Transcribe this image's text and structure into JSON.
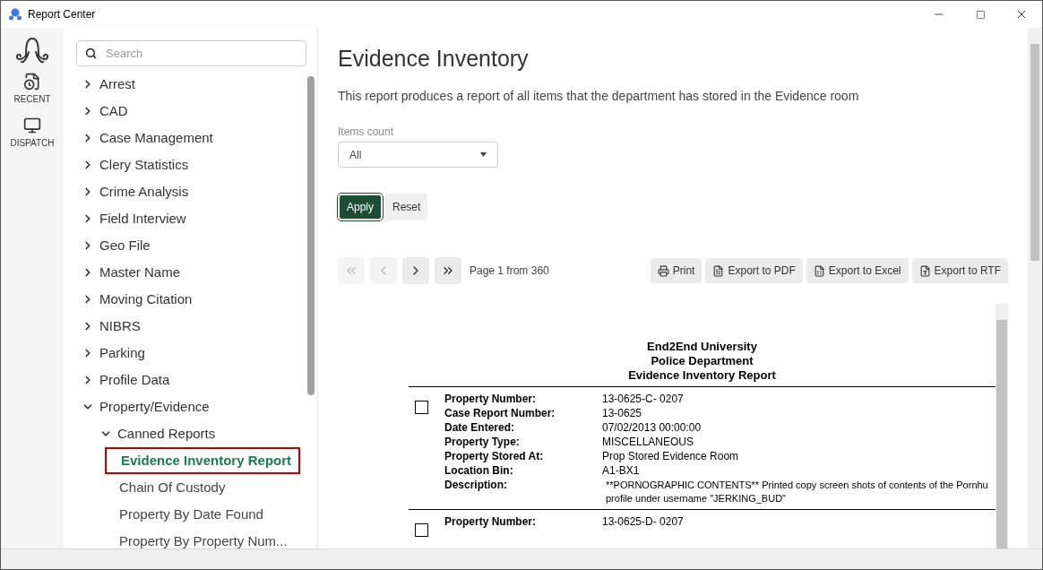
{
  "window": {
    "title": "Report Center"
  },
  "rail": [
    {
      "label": "RECENT",
      "kind": "recent"
    },
    {
      "label": "DISPATCH",
      "kind": "dispatch"
    }
  ],
  "tree": {
    "search": {
      "placeholder": "Search"
    },
    "items": [
      {
        "label": "Arrest",
        "expanded": false
      },
      {
        "label": "CAD",
        "expanded": false
      },
      {
        "label": "Case Management",
        "expanded": false
      },
      {
        "label": "Clery Statistics",
        "expanded": false
      },
      {
        "label": "Crime Analysis",
        "expanded": false
      },
      {
        "label": "Field Interview",
        "expanded": false
      },
      {
        "label": "Geo File",
        "expanded": false
      },
      {
        "label": "Master Name",
        "expanded": false
      },
      {
        "label": "Moving Citation",
        "expanded": false
      },
      {
        "label": "NIBRS",
        "expanded": false
      },
      {
        "label": "Parking",
        "expanded": false
      },
      {
        "label": "Profile Data",
        "expanded": false
      },
      {
        "label": "Property/Evidence",
        "expanded": true,
        "children": [
          {
            "label": "Canned Reports",
            "expanded": true,
            "children": [
              {
                "label": "Evidence Inventory Report",
                "selected": true
              },
              {
                "label": "Chain Of Custody",
                "selected": false
              },
              {
                "label": "Property By Date Found",
                "selected": false
              },
              {
                "label": "Property By Property Num...",
                "selected": false
              }
            ]
          }
        ]
      }
    ]
  },
  "main": {
    "title": "Evidence Inventory",
    "description": "This report produces a report of all items that the department has stored in the Evidence room",
    "filter": {
      "label": "Items count",
      "value": "All"
    },
    "actions": [
      {
        "label": "Apply",
        "kind": "primary"
      },
      {
        "label": "Reset",
        "kind": "secondary"
      }
    ],
    "pager": {
      "buttons": [
        {
          "kind": "first",
          "disabled": true
        },
        {
          "kind": "prev",
          "disabled": true
        },
        {
          "kind": "next",
          "disabled": false
        },
        {
          "kind": "last",
          "disabled": false
        }
      ],
      "status": "Page 1 from 360"
    },
    "exports": [
      {
        "label": "Print",
        "kind": "print"
      },
      {
        "label": "Export to PDF",
        "kind": "pdf"
      },
      {
        "label": "Export to Excel",
        "kind": "excel"
      },
      {
        "label": "Export to RTF",
        "kind": "rtf"
      }
    ],
    "report": {
      "heading": [
        "End2End University",
        "Police Department",
        "Evidence Inventory Report"
      ],
      "records": [
        {
          "checked": false,
          "fields": [
            {
              "label": "Property Number:",
              "value": "13-0625-C- 0207"
            },
            {
              "label": "Case Report Number:",
              "value": "13-0625"
            },
            {
              "label": "Date Entered:",
              "value": "07/02/2013 00:00:00"
            },
            {
              "label": "Property Type:",
              "value": "MISCELLANEOUS"
            },
            {
              "label": "Property  Stored At:",
              "value": "Prop Stored Evidence Room"
            },
            {
              "label": "Location Bin:",
              "value": "A1-BX1"
            },
            {
              "label": "Description:",
              "value": "**PORNOGRAPHIC CONTENTS** Printed copy screen shots of contents of the Pornhu profile under username \"JERKING_BUD\"",
              "kind": "small"
            }
          ]
        },
        {
          "checked": false,
          "fields": [
            {
              "label": "Property Number:",
              "value": "13-0625-D- 0207"
            }
          ]
        }
      ]
    }
  }
}
